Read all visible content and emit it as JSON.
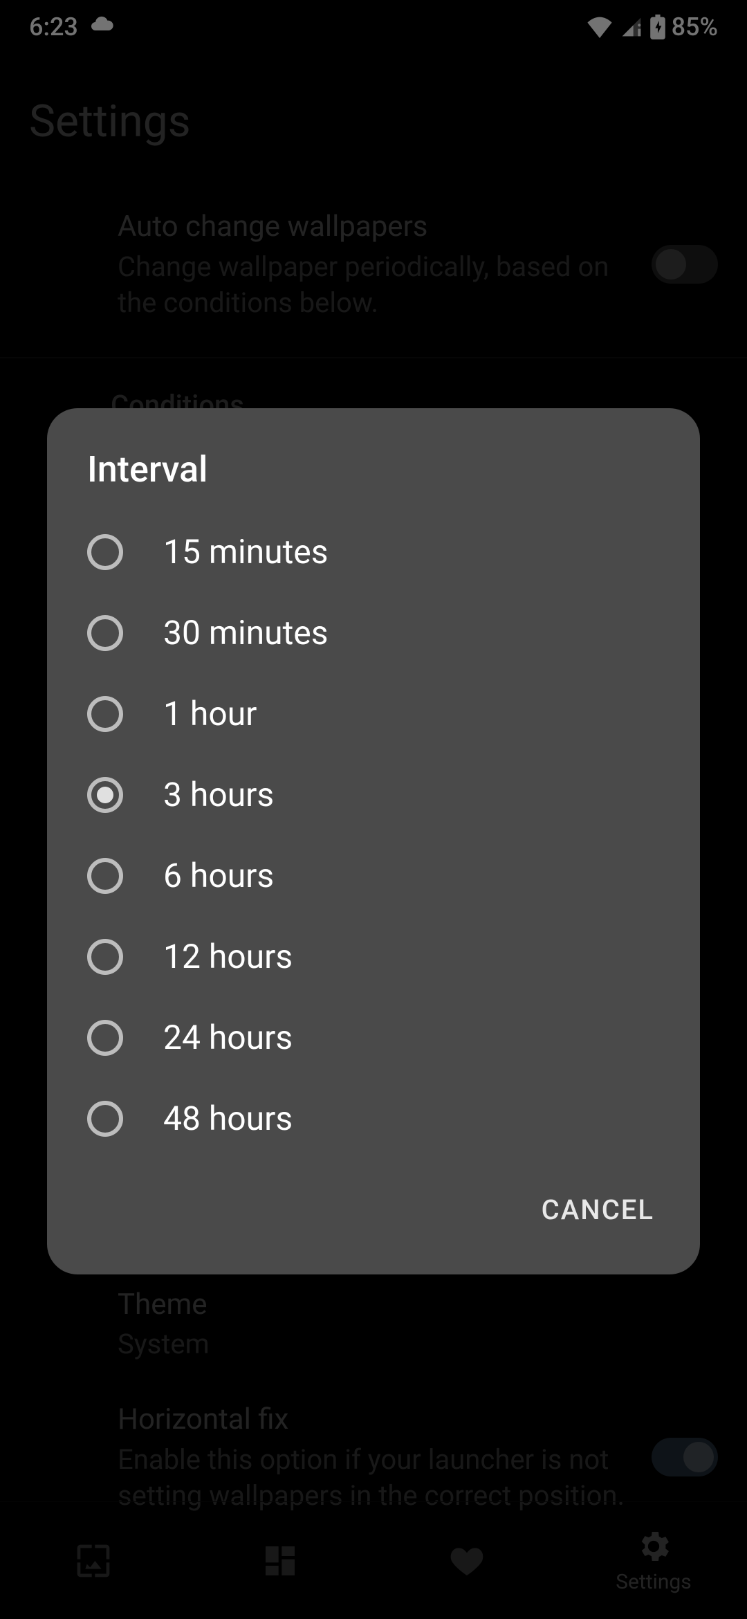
{
  "status": {
    "time": "6:23",
    "battery": "85%"
  },
  "page": {
    "title": "Settings",
    "auto_change": {
      "title": "Auto change wallpapers",
      "sub": "Change wallpaper periodically, based on the conditions below."
    },
    "conditions_label": "Conditions",
    "theme": {
      "title": "Theme",
      "value": "System"
    },
    "horizontal_fix": {
      "title": "Horizontal fix",
      "sub": "Enable this option if your launcher is not setting wallpapers in the correct position."
    }
  },
  "dialog": {
    "title": "Interval",
    "options": [
      "15 minutes",
      "30 minutes",
      "1 hour",
      "3 hours",
      "6 hours",
      "12 hours",
      "24 hours",
      "48 hours"
    ],
    "selected_index": 3,
    "cancel": "CANCEL"
  },
  "nav": {
    "settings_label": "Settings"
  }
}
